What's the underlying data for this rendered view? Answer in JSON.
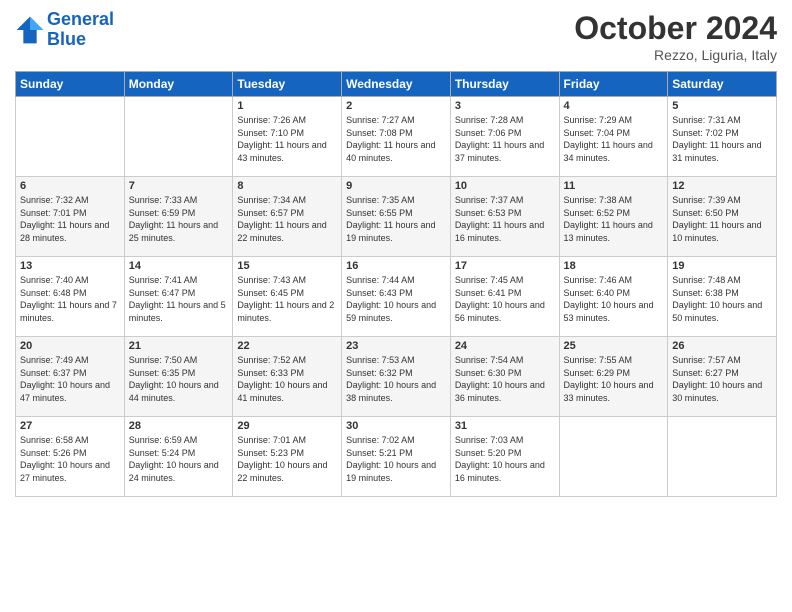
{
  "header": {
    "logo_line1": "General",
    "logo_line2": "Blue",
    "month": "October 2024",
    "location": "Rezzo, Liguria, Italy"
  },
  "days_of_week": [
    "Sunday",
    "Monday",
    "Tuesday",
    "Wednesday",
    "Thursday",
    "Friday",
    "Saturday"
  ],
  "weeks": [
    [
      {
        "day": "",
        "sunrise": "",
        "sunset": "",
        "daylight": ""
      },
      {
        "day": "",
        "sunrise": "",
        "sunset": "",
        "daylight": ""
      },
      {
        "day": "1",
        "sunrise": "Sunrise: 7:26 AM",
        "sunset": "Sunset: 7:10 PM",
        "daylight": "Daylight: 11 hours and 43 minutes."
      },
      {
        "day": "2",
        "sunrise": "Sunrise: 7:27 AM",
        "sunset": "Sunset: 7:08 PM",
        "daylight": "Daylight: 11 hours and 40 minutes."
      },
      {
        "day": "3",
        "sunrise": "Sunrise: 7:28 AM",
        "sunset": "Sunset: 7:06 PM",
        "daylight": "Daylight: 11 hours and 37 minutes."
      },
      {
        "day": "4",
        "sunrise": "Sunrise: 7:29 AM",
        "sunset": "Sunset: 7:04 PM",
        "daylight": "Daylight: 11 hours and 34 minutes."
      },
      {
        "day": "5",
        "sunrise": "Sunrise: 7:31 AM",
        "sunset": "Sunset: 7:02 PM",
        "daylight": "Daylight: 11 hours and 31 minutes."
      }
    ],
    [
      {
        "day": "6",
        "sunrise": "Sunrise: 7:32 AM",
        "sunset": "Sunset: 7:01 PM",
        "daylight": "Daylight: 11 hours and 28 minutes."
      },
      {
        "day": "7",
        "sunrise": "Sunrise: 7:33 AM",
        "sunset": "Sunset: 6:59 PM",
        "daylight": "Daylight: 11 hours and 25 minutes."
      },
      {
        "day": "8",
        "sunrise": "Sunrise: 7:34 AM",
        "sunset": "Sunset: 6:57 PM",
        "daylight": "Daylight: 11 hours and 22 minutes."
      },
      {
        "day": "9",
        "sunrise": "Sunrise: 7:35 AM",
        "sunset": "Sunset: 6:55 PM",
        "daylight": "Daylight: 11 hours and 19 minutes."
      },
      {
        "day": "10",
        "sunrise": "Sunrise: 7:37 AM",
        "sunset": "Sunset: 6:53 PM",
        "daylight": "Daylight: 11 hours and 16 minutes."
      },
      {
        "day": "11",
        "sunrise": "Sunrise: 7:38 AM",
        "sunset": "Sunset: 6:52 PM",
        "daylight": "Daylight: 11 hours and 13 minutes."
      },
      {
        "day": "12",
        "sunrise": "Sunrise: 7:39 AM",
        "sunset": "Sunset: 6:50 PM",
        "daylight": "Daylight: 11 hours and 10 minutes."
      }
    ],
    [
      {
        "day": "13",
        "sunrise": "Sunrise: 7:40 AM",
        "sunset": "Sunset: 6:48 PM",
        "daylight": "Daylight: 11 hours and 7 minutes."
      },
      {
        "day": "14",
        "sunrise": "Sunrise: 7:41 AM",
        "sunset": "Sunset: 6:47 PM",
        "daylight": "Daylight: 11 hours and 5 minutes."
      },
      {
        "day": "15",
        "sunrise": "Sunrise: 7:43 AM",
        "sunset": "Sunset: 6:45 PM",
        "daylight": "Daylight: 11 hours and 2 minutes."
      },
      {
        "day": "16",
        "sunrise": "Sunrise: 7:44 AM",
        "sunset": "Sunset: 6:43 PM",
        "daylight": "Daylight: 10 hours and 59 minutes."
      },
      {
        "day": "17",
        "sunrise": "Sunrise: 7:45 AM",
        "sunset": "Sunset: 6:41 PM",
        "daylight": "Daylight: 10 hours and 56 minutes."
      },
      {
        "day": "18",
        "sunrise": "Sunrise: 7:46 AM",
        "sunset": "Sunset: 6:40 PM",
        "daylight": "Daylight: 10 hours and 53 minutes."
      },
      {
        "day": "19",
        "sunrise": "Sunrise: 7:48 AM",
        "sunset": "Sunset: 6:38 PM",
        "daylight": "Daylight: 10 hours and 50 minutes."
      }
    ],
    [
      {
        "day": "20",
        "sunrise": "Sunrise: 7:49 AM",
        "sunset": "Sunset: 6:37 PM",
        "daylight": "Daylight: 10 hours and 47 minutes."
      },
      {
        "day": "21",
        "sunrise": "Sunrise: 7:50 AM",
        "sunset": "Sunset: 6:35 PM",
        "daylight": "Daylight: 10 hours and 44 minutes."
      },
      {
        "day": "22",
        "sunrise": "Sunrise: 7:52 AM",
        "sunset": "Sunset: 6:33 PM",
        "daylight": "Daylight: 10 hours and 41 minutes."
      },
      {
        "day": "23",
        "sunrise": "Sunrise: 7:53 AM",
        "sunset": "Sunset: 6:32 PM",
        "daylight": "Daylight: 10 hours and 38 minutes."
      },
      {
        "day": "24",
        "sunrise": "Sunrise: 7:54 AM",
        "sunset": "Sunset: 6:30 PM",
        "daylight": "Daylight: 10 hours and 36 minutes."
      },
      {
        "day": "25",
        "sunrise": "Sunrise: 7:55 AM",
        "sunset": "Sunset: 6:29 PM",
        "daylight": "Daylight: 10 hours and 33 minutes."
      },
      {
        "day": "26",
        "sunrise": "Sunrise: 7:57 AM",
        "sunset": "Sunset: 6:27 PM",
        "daylight": "Daylight: 10 hours and 30 minutes."
      }
    ],
    [
      {
        "day": "27",
        "sunrise": "Sunrise: 6:58 AM",
        "sunset": "Sunset: 5:26 PM",
        "daylight": "Daylight: 10 hours and 27 minutes."
      },
      {
        "day": "28",
        "sunrise": "Sunrise: 6:59 AM",
        "sunset": "Sunset: 5:24 PM",
        "daylight": "Daylight: 10 hours and 24 minutes."
      },
      {
        "day": "29",
        "sunrise": "Sunrise: 7:01 AM",
        "sunset": "Sunset: 5:23 PM",
        "daylight": "Daylight: 10 hours and 22 minutes."
      },
      {
        "day": "30",
        "sunrise": "Sunrise: 7:02 AM",
        "sunset": "Sunset: 5:21 PM",
        "daylight": "Daylight: 10 hours and 19 minutes."
      },
      {
        "day": "31",
        "sunrise": "Sunrise: 7:03 AM",
        "sunset": "Sunset: 5:20 PM",
        "daylight": "Daylight: 10 hours and 16 minutes."
      },
      {
        "day": "",
        "sunrise": "",
        "sunset": "",
        "daylight": ""
      },
      {
        "day": "",
        "sunrise": "",
        "sunset": "",
        "daylight": ""
      }
    ]
  ]
}
